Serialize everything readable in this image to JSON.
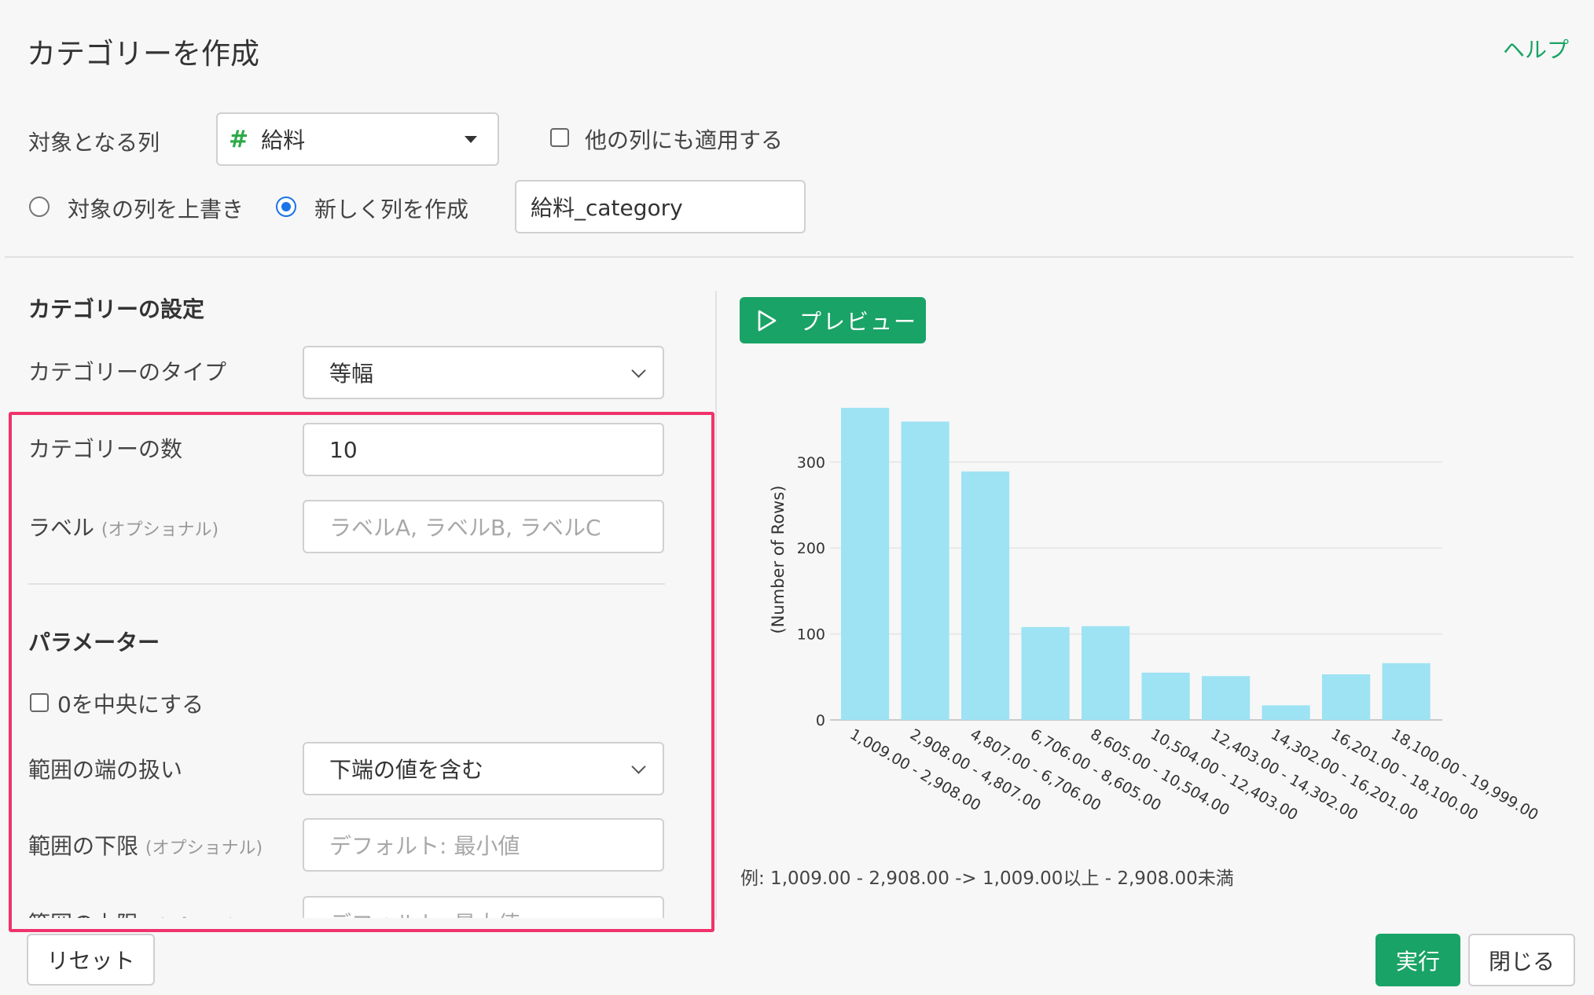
{
  "header": {
    "title": "カテゴリーを作成",
    "help": "ヘルプ"
  },
  "target": {
    "label": "対象となる列",
    "hash": "#",
    "column": "給料",
    "apply_other": "他の列にも適用する",
    "apply_other_checked": false
  },
  "mode": {
    "overwrite": "対象の列を上書き",
    "create_new": "新しく列を作成",
    "selected": "create_new",
    "new_column_name": "給料_category"
  },
  "settings": {
    "section_title": "カテゴリーの設定",
    "type_label": "カテゴリーのタイプ",
    "type_value": "等幅",
    "count_label": "カテゴリーの数",
    "count_value": "10",
    "label_label": "ラベル",
    "optional": "(オプショナル)",
    "label_placeholder": "ラベルA, ラベルB, ラベルC"
  },
  "parameters": {
    "section_title": "パラメーター",
    "center_zero": "0を中央にする",
    "center_zero_checked": false,
    "edge_label": "範囲の端の扱い",
    "edge_value": "下端の値を含む",
    "lower_label": "範囲の下限",
    "lower_placeholder": "デフォルト: 最小値",
    "upper_label": "範囲の上限",
    "upper_placeholder": "デフォルト: 最大値"
  },
  "preview": {
    "button": "プレビュー"
  },
  "chart_data": {
    "type": "bar",
    "ylabel": "(Number of Rows)",
    "ylim": [
      0,
      362
    ],
    "yticks": [
      0,
      100,
      200,
      300
    ],
    "grid": true,
    "bar_color": "#9de3f3",
    "categories": [
      "1,009.00 - 2,908.00",
      "2,908.00 - 4,807.00",
      "4,807.00 - 6,706.00",
      "6,706.00 - 8,605.00",
      "8,605.00 - 10,504.00",
      "10,504.00 - 12,403.00",
      "12,403.00 - 14,302.00",
      "14,302.00 - 16,201.00",
      "16,201.00 - 18,100.00",
      "18,100.00 - 19,999.00"
    ],
    "values": [
      363,
      347,
      289,
      108,
      109,
      55,
      51,
      17,
      53,
      66
    ]
  },
  "note": "例: 1,009.00 - 2,908.00 -> 1,009.00以上 - 2,908.00未満",
  "footer": {
    "reset": "リセット",
    "run": "実行",
    "close": "閉じる"
  },
  "colors": {
    "accent": "#1aa366",
    "highlight": "#f0336c",
    "radio": "#1a73e8"
  }
}
